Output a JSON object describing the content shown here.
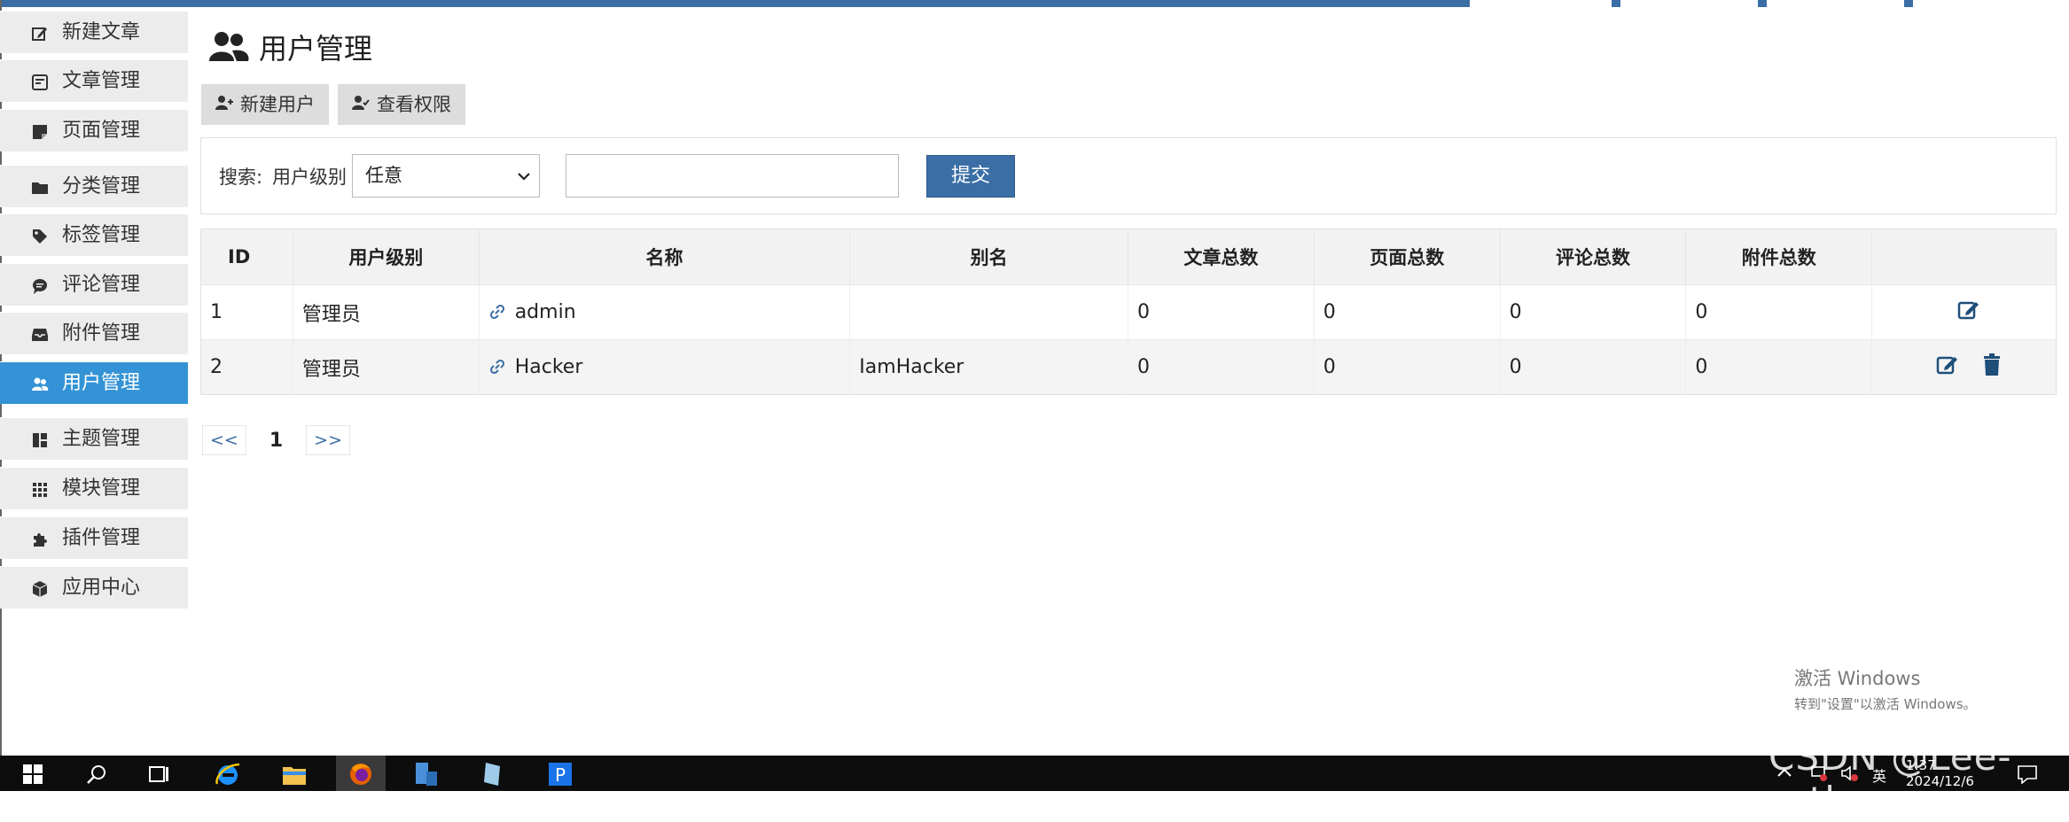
{
  "sidebar": {
    "items": [
      {
        "label": "新建文章",
        "icon": "edit-icon"
      },
      {
        "label": "文章管理",
        "icon": "article-icon"
      },
      {
        "label": "页面管理",
        "icon": "page-icon"
      },
      {
        "label": "分类管理",
        "icon": "folder-icon"
      },
      {
        "label": "标签管理",
        "icon": "tag-icon"
      },
      {
        "label": "评论管理",
        "icon": "comment-icon"
      },
      {
        "label": "附件管理",
        "icon": "inbox-icon"
      },
      {
        "label": "用户管理",
        "icon": "users-icon",
        "active": true
      },
      {
        "label": "主题管理",
        "icon": "layout-icon"
      },
      {
        "label": "模块管理",
        "icon": "grid-icon"
      },
      {
        "label": "插件管理",
        "icon": "puzzle-icon"
      },
      {
        "label": "应用中心",
        "icon": "cube-icon"
      }
    ]
  },
  "page": {
    "title": "用户管理",
    "buttons": {
      "new_user": "新建用户",
      "view_permissions": "查看权限"
    }
  },
  "search": {
    "label": "搜索:",
    "level_label": "用户级别",
    "level_selected": "任意",
    "input_value": "",
    "submit": "提交"
  },
  "table": {
    "headers": [
      "ID",
      "用户级别",
      "名称",
      "别名",
      "文章总数",
      "页面总数",
      "评论总数",
      "附件总数",
      ""
    ],
    "rows": [
      {
        "id": "1",
        "level": "管理员",
        "name": "admin",
        "alias": "",
        "posts": "0",
        "pages": "0",
        "comments": "0",
        "attachments": "0"
      },
      {
        "id": "2",
        "level": "管理员",
        "name": "Hacker",
        "alias": "IamHacker",
        "posts": "0",
        "pages": "0",
        "comments": "0",
        "attachments": "0"
      }
    ]
  },
  "pager": {
    "prev": "<<",
    "current": "1",
    "next": ">>"
  },
  "watermark": {
    "line1": "激活 Windows",
    "line2": "转到\"设置\"以激活 Windows。",
    "csdn": "CSDN @Lee-ruth"
  },
  "taskbar": {
    "ime": "英",
    "time": "1:37",
    "date": "2024/12/6"
  },
  "colors": {
    "accent": "#3a6ea5",
    "active_sidebar": "#3493d6"
  }
}
